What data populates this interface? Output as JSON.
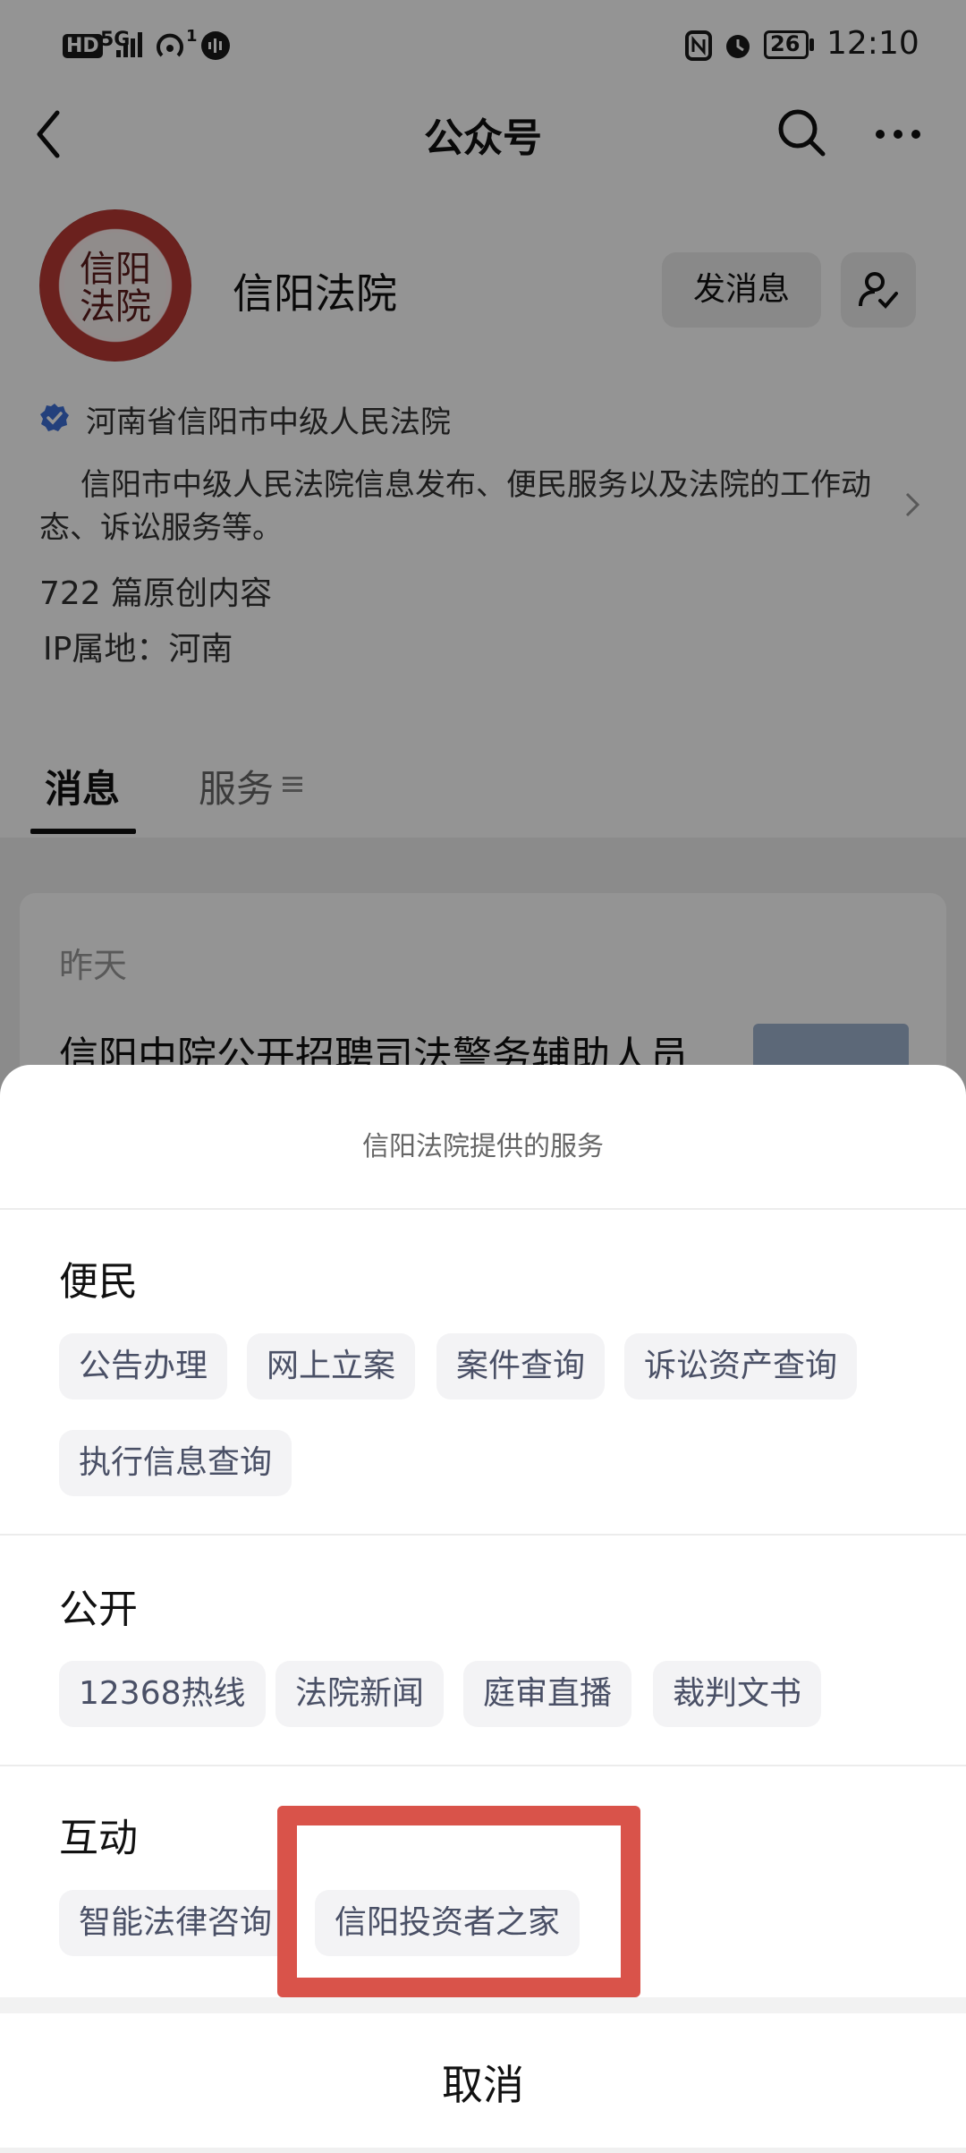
{
  "status_bar": {
    "hd": "HD",
    "network": "5G",
    "wifi_badge": "1",
    "battery": "26",
    "time": "12:10"
  },
  "nav": {
    "title": "公众号"
  },
  "profile": {
    "avatar_text": "信阳\n法院",
    "name": "信阳法院",
    "send_message": "发消息",
    "org": "河南省信阳市中级人民法院",
    "description": "信阳市中级人民法院信息发布、便民服务以及法院的工作动态、诉讼服务等。",
    "original_count": "722 篇原创内容",
    "ip": "IP属地：河南"
  },
  "tabs": [
    {
      "label": "消息"
    },
    {
      "label": "服务"
    }
  ],
  "feed": {
    "date": "昨天",
    "title": "信阳中院公开招聘司法警务辅助人员"
  },
  "sheet": {
    "title": "信阳法院提供的服务",
    "sections": [
      {
        "title": "便民",
        "items": [
          "公告办理",
          "网上立案",
          "案件查询",
          "诉讼资产查询",
          "执行信息查询"
        ]
      },
      {
        "title": "公开",
        "items": [
          "12368热线",
          "法院新闻",
          "庭审直播",
          "裁判文书"
        ]
      },
      {
        "title": "互动",
        "items": [
          "智能法律咨询",
          "信阳投资者之家"
        ]
      }
    ],
    "cancel": "取消"
  },
  "colors": {
    "highlight": "#d9534a",
    "verify": "#3d6fd6",
    "chip_text": "#4a5066"
  }
}
